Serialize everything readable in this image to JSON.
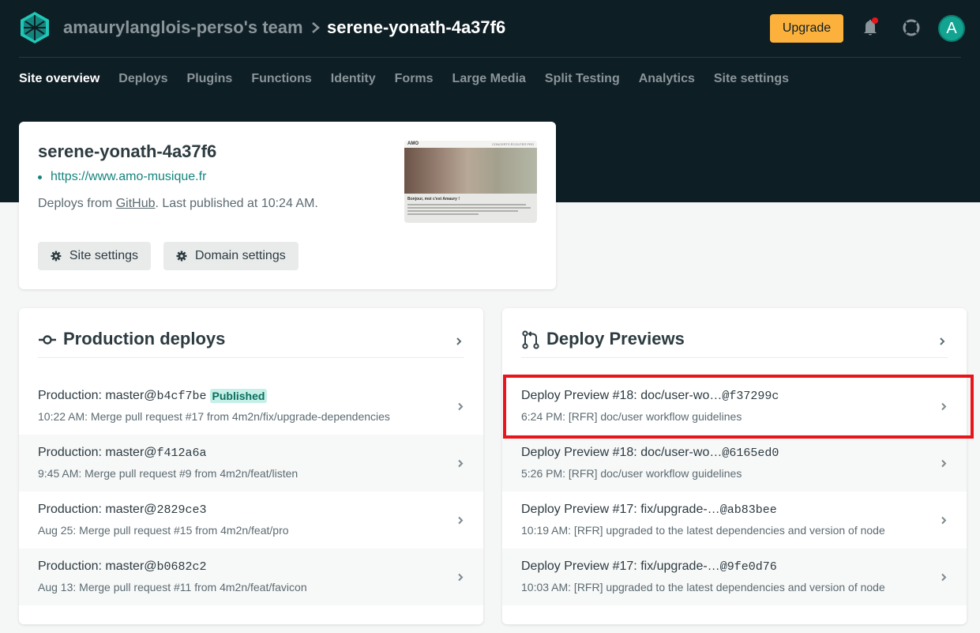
{
  "header": {
    "team": "amaurylanglois-perso's team",
    "site_name": "serene-yonath-4a37f6",
    "upgrade_label": "Upgrade",
    "avatar_letter": "A",
    "icons": [
      "netlify-logo-icon",
      "chevron-right-icon",
      "bell-icon",
      "lifebuoy-icon"
    ],
    "notification_dot_color": "#e8161b"
  },
  "nav": {
    "items": [
      {
        "label": "Site overview",
        "active": true
      },
      {
        "label": "Deploys"
      },
      {
        "label": "Plugins"
      },
      {
        "label": "Functions"
      },
      {
        "label": "Identity"
      },
      {
        "label": "Forms"
      },
      {
        "label": "Large Media"
      },
      {
        "label": "Split Testing"
      },
      {
        "label": "Analytics"
      },
      {
        "label": "Site settings"
      }
    ]
  },
  "site": {
    "title": "serene-yonath-4a37f6",
    "url": "https://www.amo-musique.fr",
    "deploys_from_prefix": "Deploys from ",
    "deploys_from_source": "GitHub",
    "deploys_from_suffix": ". Last published at 10:24 AM.",
    "site_settings_label": "Site settings",
    "domain_settings_label": "Domain settings",
    "thumbnail": {
      "logo": "AMO",
      "nav": "CONCERTS   ÉCOUTER   PRO",
      "heading": "Bonjour, moi c'est Amaury !"
    }
  },
  "production": {
    "title": "Production deploys",
    "deploys": [
      {
        "label": "Production: master@",
        "sha": "b4cf7be",
        "badge": "Published",
        "message": "10:22 AM: Merge pull request #17 from 4m2n/fix/upgrade-dependencies"
      },
      {
        "label": "Production: master@",
        "sha": "f412a6a",
        "badge": "",
        "message": "9:45 AM: Merge pull request #9 from 4m2n/feat/listen"
      },
      {
        "label": "Production: master@",
        "sha": "2829ce3",
        "badge": "",
        "message": "Aug 25: Merge pull request #15 from 4m2n/feat/pro"
      },
      {
        "label": "Production: master@",
        "sha": "b0682c2",
        "badge": "",
        "message": "Aug 13: Merge pull request #11 from 4m2n/feat/favicon"
      }
    ]
  },
  "previews": {
    "title": "Deploy Previews",
    "deploys": [
      {
        "label": "Deploy Preview #18: doc/user-wo…",
        "sha": "@f37299c",
        "message": "6:24 PM: [RFR] doc/user workflow guidelines"
      },
      {
        "label": "Deploy Preview #18: doc/user-wo…",
        "sha": "@6165ed0",
        "message": "5:26 PM: [RFR] doc/user workflow guidelines"
      },
      {
        "label": "Deploy Preview #17: fix/upgrade-…",
        "sha": "@ab83bee",
        "message": "10:19 AM: [RFR] upgraded to the latest dependencies and version of node"
      },
      {
        "label": "Deploy Preview #17: fix/upgrade-…",
        "sha": "@9fe0d76",
        "message": "10:03 AM: [RFR] upgraded to the latest dependencies and version of node"
      }
    ]
  },
  "colors": {
    "header_bg": "#0e1e25",
    "accent": "#15847d",
    "upgrade_bg": "#fbb13c",
    "badge_bg": "#c6f0e7",
    "highlight": "#e8161b"
  }
}
